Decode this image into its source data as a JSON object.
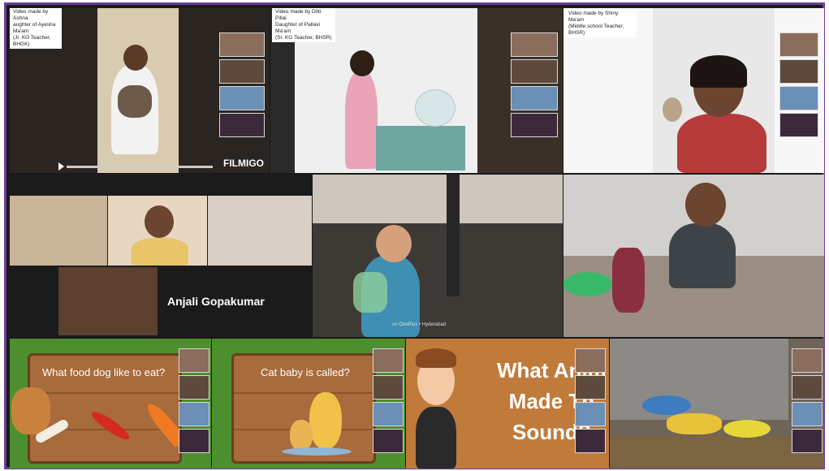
{
  "colors": {
    "frame": "#6a3d9a",
    "tile_dark": "#1a1a1a",
    "board": "#a86b3c",
    "jungle": "#4d8f2e",
    "video_bg": "#c07a3a"
  },
  "tiles": {
    "t1": {
      "caption_line1": "Video made by Ashna",
      "caption_line2": "aughter of Ayesha Ma'am",
      "caption_line3": "(Jr. KG Teacher, BHGK)",
      "watermark": "FILMIGO"
    },
    "t2": {
      "caption_line1": "Video made by Ditti Pillai",
      "caption_line2": "Daughter of Pallavi Ma'am",
      "caption_line3": "(Sr. KG Teacher, BHSR)"
    },
    "t3": {
      "caption_line1": "Video made by Shiny Ma'am",
      "caption_line2": "(Middle school Teacher, BHSR)"
    },
    "t4": {
      "participant_name": "Anjali Gopakumar"
    },
    "t5": {
      "overlay_text": "on OnePlus  • Hyderabad"
    },
    "t6": {},
    "t7": {
      "question": "What food dog like to eat?"
    },
    "t8": {
      "question": "Cat baby is called?"
    },
    "t9": {
      "title_line1": "What Anim",
      "title_line2": "Made Th",
      "title_line3": "Sound?"
    },
    "t10": {}
  }
}
